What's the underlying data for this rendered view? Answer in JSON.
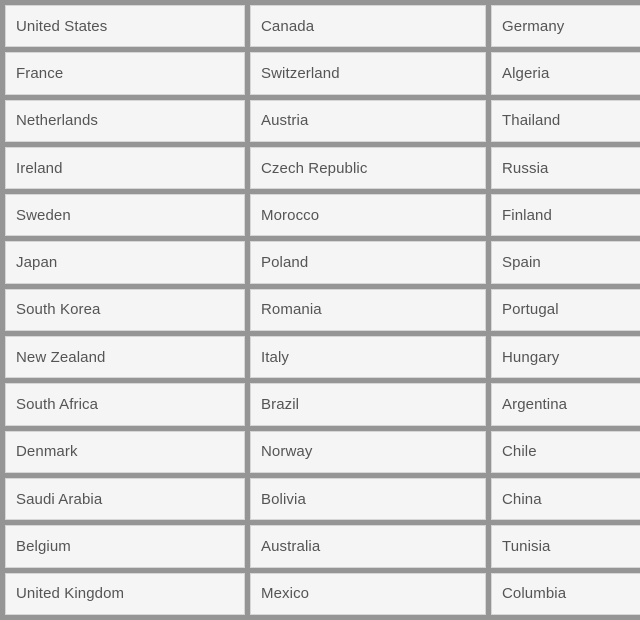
{
  "table": {
    "name": "country-list-table",
    "columns": 3,
    "rows_count": 13,
    "colors": {
      "grid_line": "#959595",
      "cell_background": "#f5f5f5",
      "cell_border": "#d6d6d6",
      "text": "#555555"
    },
    "rows": [
      {
        "c1": "United States",
        "c2": "Canada",
        "c3": "Germany"
      },
      {
        "c1": "France",
        "c2": "Switzerland",
        "c3": "Algeria"
      },
      {
        "c1": "Netherlands",
        "c2": "Austria",
        "c3": "Thailand"
      },
      {
        "c1": "Ireland",
        "c2": "Czech Republic",
        "c3": "Russia"
      },
      {
        "c1": "Sweden",
        "c2": "Morocco",
        "c3": "Finland"
      },
      {
        "c1": "Japan",
        "c2": "Poland",
        "c3": "Spain"
      },
      {
        "c1": "South Korea",
        "c2": "Romania",
        "c3": "Portugal"
      },
      {
        "c1": "New Zealand",
        "c2": "Italy",
        "c3": "Hungary"
      },
      {
        "c1": "South Africa",
        "c2": "Brazil",
        "c3": "Argentina"
      },
      {
        "c1": "Denmark",
        "c2": "Norway",
        "c3": "Chile"
      },
      {
        "c1": "Saudi Arabia",
        "c2": "Bolivia",
        "c3": "China"
      },
      {
        "c1": "Belgium",
        "c2": "Australia",
        "c3": "Tunisia"
      },
      {
        "c1": "United Kingdom",
        "c2": "Mexico",
        "c3": "Columbia"
      }
    ]
  }
}
